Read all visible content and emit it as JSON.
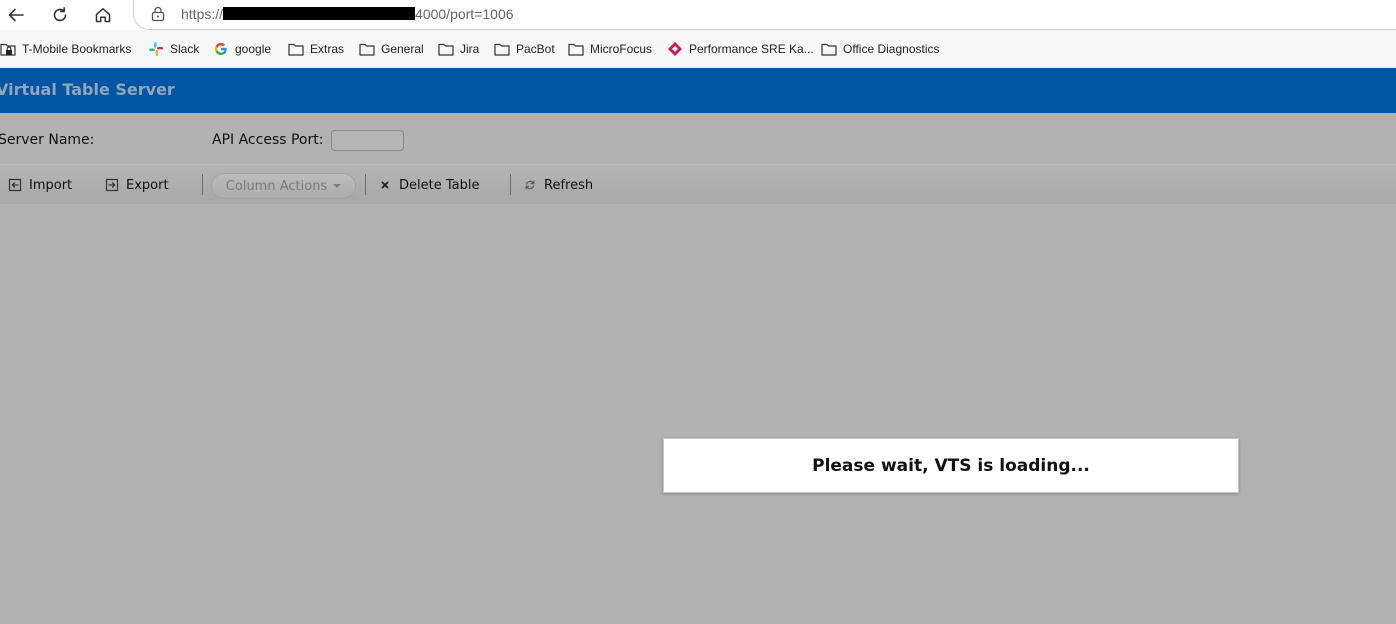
{
  "browser": {
    "url_prefix": "https://",
    "url_suffix": "4000/port=1006"
  },
  "bookmarks": [
    {
      "label": "T-Mobile Bookmarks",
      "icon": "folder-lock-icon"
    },
    {
      "label": "Slack",
      "icon": "slack-icon"
    },
    {
      "label": "google",
      "icon": "google-icon"
    },
    {
      "label": "Extras",
      "icon": "folder-icon"
    },
    {
      "label": "General",
      "icon": "folder-icon"
    },
    {
      "label": "Jira",
      "icon": "folder-icon"
    },
    {
      "label": "PacBot",
      "icon": "folder-icon"
    },
    {
      "label": "MicroFocus",
      "icon": "folder-icon"
    },
    {
      "label": "Performance SRE Ka...",
      "icon": "diamond-icon"
    },
    {
      "label": "Office Diagnostics",
      "icon": "folder-icon"
    }
  ],
  "app": {
    "title": "Virtual Table Server",
    "server_name_label": "Server Name:",
    "api_port_label": "API Access Port:",
    "api_port_value": ""
  },
  "toolbar": {
    "import_label": "Import",
    "export_label": "Export",
    "column_actions_label": "Column Actions",
    "delete_table_label": "Delete Table",
    "refresh_label": "Refresh"
  },
  "loading": {
    "message": "Please wait, VTS is loading..."
  },
  "colors": {
    "header_blue": "#0155a5",
    "overlay_gray": "#b2b2b2",
    "diamond_magenta": "#d4145a"
  }
}
